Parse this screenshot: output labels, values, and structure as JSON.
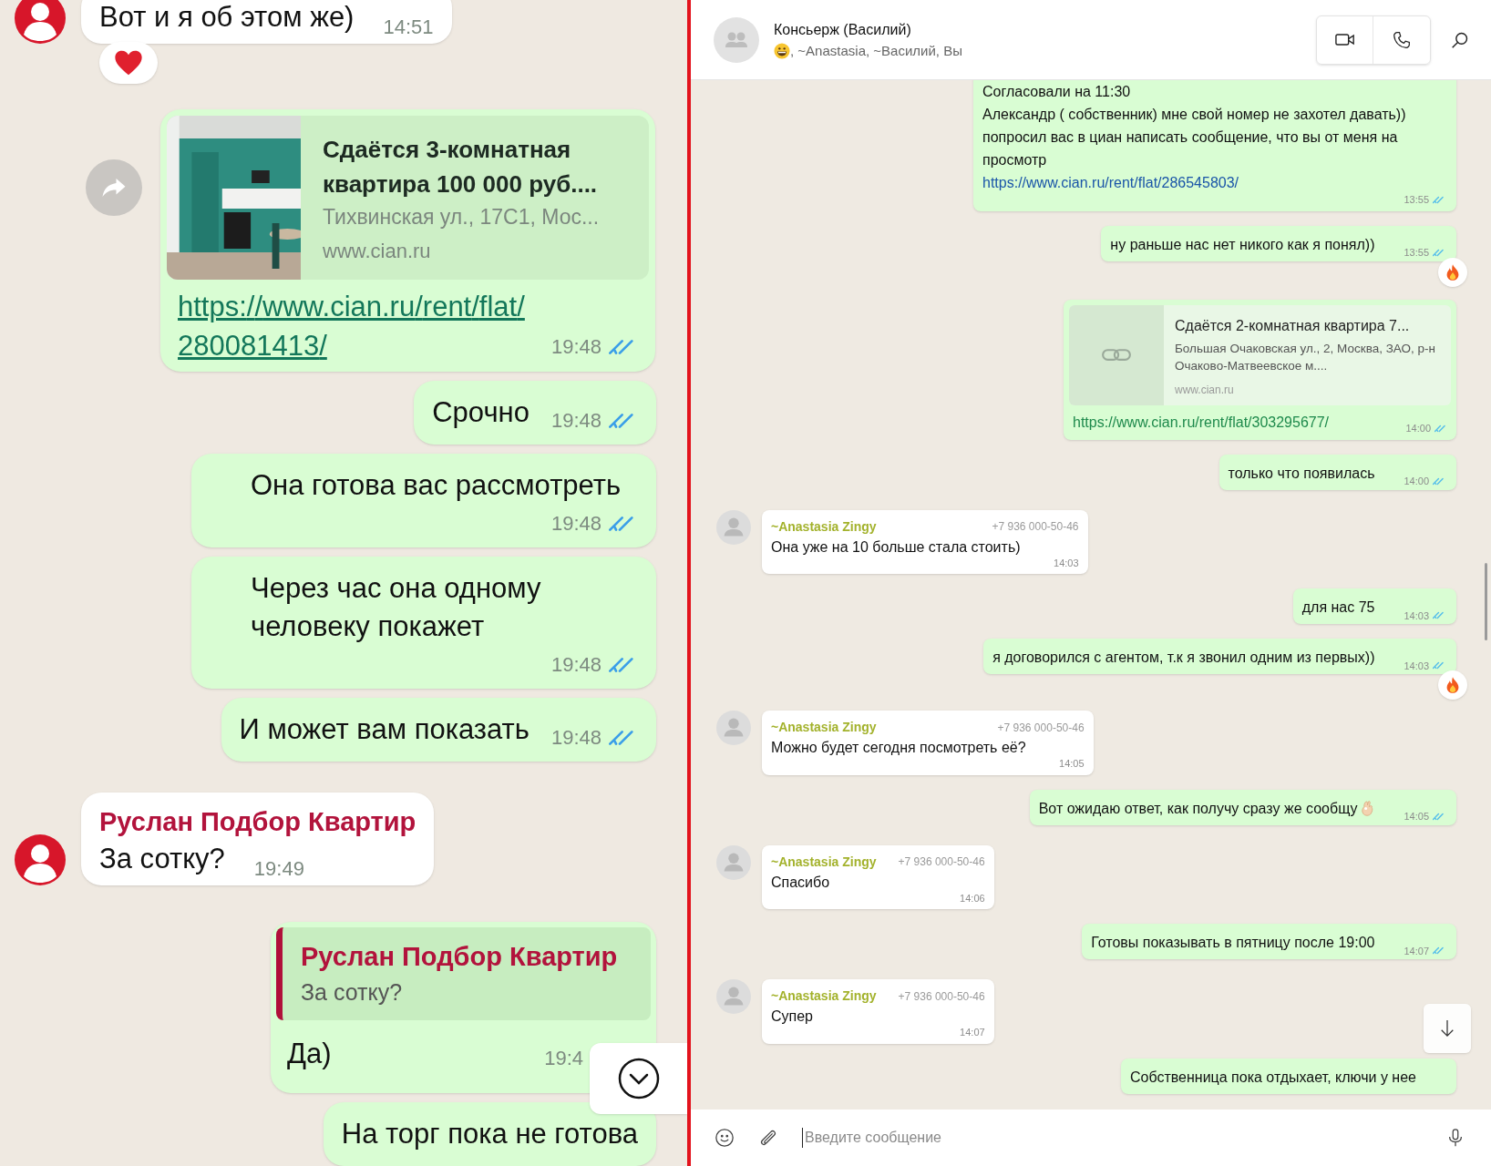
{
  "left_chat": {
    "messages": [
      {
        "kind": "incoming",
        "text": "Вот и я об этом же)",
        "time": "14:51",
        "reaction": true
      },
      {
        "kind": "link",
        "title": "Сдаётся 3-комнатная квартира 100 000 руб....",
        "subtitle": "Тихвинская ул., 17С1, Мос...",
        "domain": "www.cian.ru",
        "url": "https://www.cian.ru/rent/flat/280081413/",
        "time": "19:48",
        "read": true
      },
      {
        "kind": "outgoing",
        "text": "Срочно",
        "time": "19:48",
        "read": true
      },
      {
        "kind": "outgoing",
        "text": "Она готова вас рассмотреть",
        "time": "19:48",
        "read": true
      },
      {
        "kind": "outgoing",
        "text": "Через час она одному человеку покажет",
        "time": "19:48",
        "read": true
      },
      {
        "kind": "outgoing",
        "text": "И может вам показать",
        "time": "19:48",
        "read": true
      },
      {
        "kind": "incoming",
        "author": "Руслан Подбор Квартир",
        "text": "За сотку?",
        "time": "19:49",
        "reaction": false
      },
      {
        "kind": "reply",
        "quote_author": "Руслан Подбор Квартир",
        "quote_text": "За сотку?",
        "text": "Да)",
        "time": "19:4"
      },
      {
        "kind": "outgoing",
        "text": "На торг пока не готова"
      }
    ]
  },
  "right_chat": {
    "header": {
      "title": "Консьерж (Василий)",
      "members": ", ~Anastasia, ~Василий, Вы"
    },
    "messages": [
      {
        "kind": "outgoing",
        "lines": [
          "Согласовали на 11:30",
          "Александр ( собственник) мне свой номер не захотел давать))",
          "попросил вас в циан написать сообщение, что вы от меня на просмотр"
        ],
        "url": "https://www.cian.ru/rent/flat/286545803/",
        "time": "13:55",
        "read": true,
        "reaction": false
      },
      {
        "kind": "outgoing",
        "text": "ну раньше нас нет никого как я понял))",
        "time": "13:55",
        "read": true,
        "reaction": true
      },
      {
        "kind": "link",
        "title": "Сдаётся 2-комнатная квартира 7...",
        "subtitle": "Большая Очаковская ул., 2, Москва, ЗАО, р-н Очаково-Матвеевское м....",
        "domain": "www.cian.ru",
        "url": "https://www.cian.ru/rent/flat/303295677/",
        "time": "14:00",
        "read": true
      },
      {
        "kind": "outgoing",
        "text": "только что появилась",
        "time": "14:00",
        "read": true,
        "reaction": false
      },
      {
        "kind": "incoming",
        "author": "~Anastasia Zingy",
        "phone": "+7 936 000-50-46",
        "text": "Она уже на 10 больше стала стоить)",
        "time": "14:03"
      },
      {
        "kind": "outgoing",
        "text": "для нас 75",
        "time": "14:03",
        "read": true,
        "reaction": false
      },
      {
        "kind": "outgoing",
        "text": "я договорился с агентом, т.к я звонил одним из первых))",
        "time": "14:03",
        "read": true,
        "reaction": true
      },
      {
        "kind": "incoming",
        "author": "~Anastasia Zingy",
        "phone": "+7 936 000-50-46",
        "text": "Можно будет сегодня посмотреть её?",
        "time": "14:05"
      },
      {
        "kind": "outgoing",
        "text": "Вот ожидаю ответ, как получу сразу же сообщу",
        "emoji": true,
        "time": "14:05",
        "read": true,
        "reaction": false
      },
      {
        "kind": "incoming",
        "author": "~Anastasia Zingy",
        "phone": "+7 936 000-50-46",
        "text": "Спасибо",
        "time": "14:06"
      },
      {
        "kind": "outgoing",
        "text": "Готовы показывать в пятницу после 19:00",
        "time": "14:07",
        "read": true,
        "reaction": false
      },
      {
        "kind": "incoming",
        "author": "~Anastasia Zingy",
        "phone": "+7 936 000-50-46",
        "text": "Супер",
        "time": "14:07"
      },
      {
        "kind": "outgoing",
        "text": "Собственница пока отдыхает, ключи у нее",
        "reaction": false
      }
    ],
    "composer": {
      "placeholder": "Введите сообщение"
    }
  }
}
